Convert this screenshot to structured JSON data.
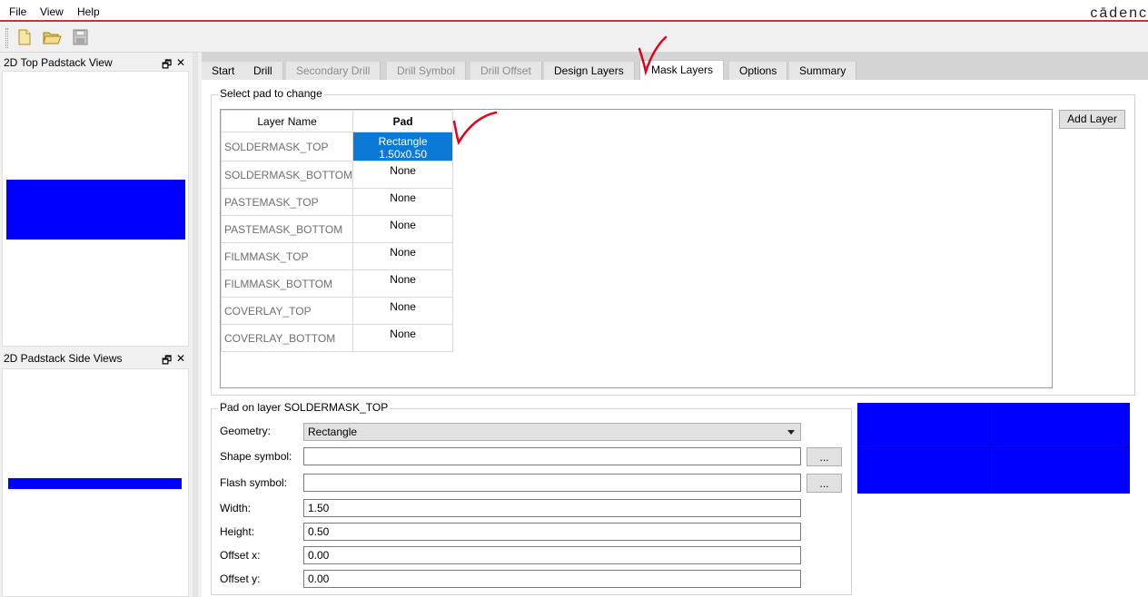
{
  "menu": {
    "file": "File",
    "view": "View",
    "help": "Help"
  },
  "brand": "cādenc",
  "toolbar": {
    "icons": [
      "new-file-icon",
      "open-folder-icon",
      "save-icon"
    ]
  },
  "docks": {
    "top_view": {
      "title": "2D Top Padstack View",
      "restore": "🗗",
      "close": "✕"
    },
    "side_view": {
      "title": "2D Padstack Side Views",
      "restore": "🗗",
      "close": "✕"
    }
  },
  "tabs": [
    "Start",
    "Drill",
    "Secondary Drill",
    "Drill Symbol",
    "Drill Offset",
    "Design Layers",
    "Mask Layers",
    "Options",
    "Summary"
  ],
  "select_group": {
    "title": "Select pad to change"
  },
  "layer_table": {
    "headers": [
      "Layer Name",
      "Pad"
    ],
    "rows": [
      {
        "layer": "SOLDERMASK_TOP",
        "pad": "Rectangle 1.50x0.50"
      },
      {
        "layer": "SOLDERMASK_BOTTOM",
        "pad": "None"
      },
      {
        "layer": "PASTEMASK_TOP",
        "pad": "None"
      },
      {
        "layer": "PASTEMASK_BOTTOM",
        "pad": "None"
      },
      {
        "layer": "FILMMASK_TOP",
        "pad": "None"
      },
      {
        "layer": "FILMMASK_BOTTOM",
        "pad": "None"
      },
      {
        "layer": "COVERLAY_TOP",
        "pad": "None"
      },
      {
        "layer": "COVERLAY_BOTTOM",
        "pad": "None"
      }
    ]
  },
  "add_layer_button": "Add Layer",
  "pad_group": {
    "title": "Pad on layer SOLDERMASK_TOP",
    "geometry_label": "Geometry:",
    "geometry_value": "Rectangle",
    "shape_symbol_label": "Shape symbol:",
    "shape_symbol_value": "",
    "flash_symbol_label": "Flash symbol:",
    "flash_symbol_value": "",
    "browse_label": "...",
    "width_label": "Width:",
    "width_value": "1.50",
    "height_label": "Height:",
    "height_value": "0.50",
    "offset_x_label": "Offset x:",
    "offset_x_value": "0.00",
    "offset_y_label": "Offset y:",
    "offset_y_value": "0.00"
  },
  "colors": {
    "pad_fill": "#0000ff",
    "selection": "#0a7ad6",
    "annotation": "#e3001b"
  }
}
